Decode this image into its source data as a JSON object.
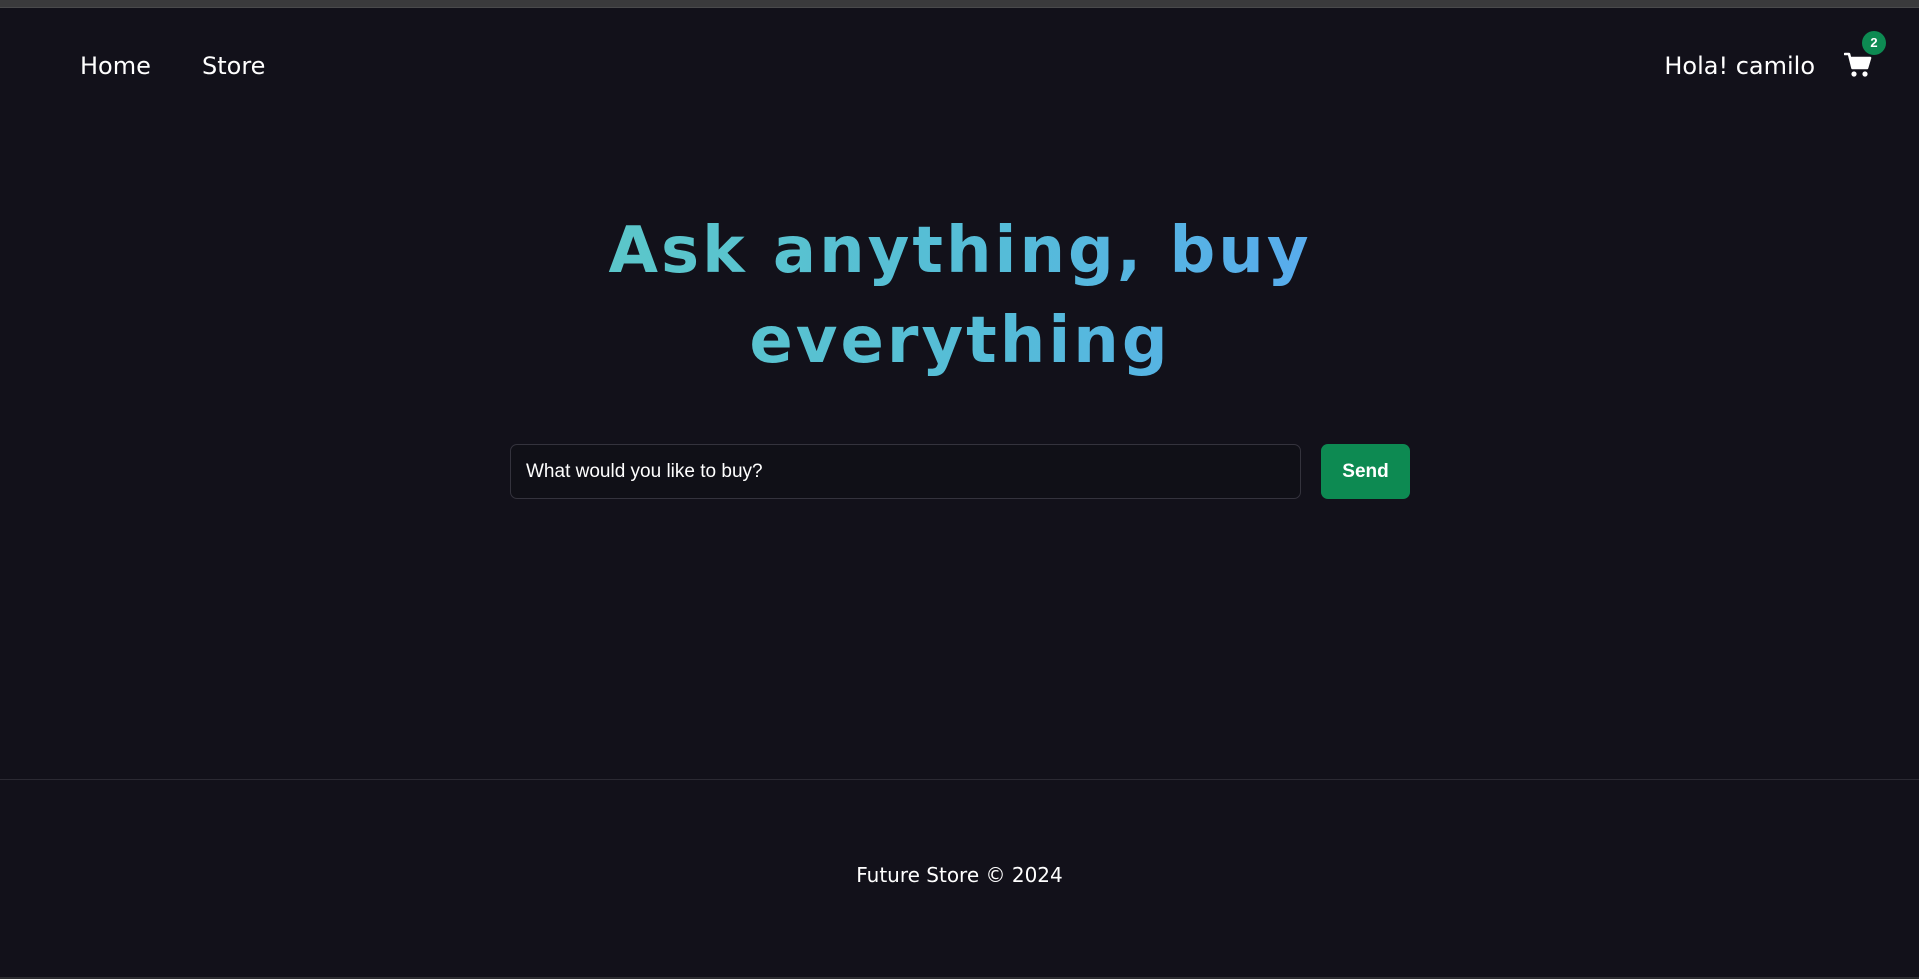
{
  "header": {
    "nav": [
      {
        "label": "Home"
      },
      {
        "label": "Store"
      }
    ],
    "greeting": "Hola! camilo",
    "cart": {
      "icon": "shopping-cart-icon",
      "count": "2"
    }
  },
  "hero": {
    "title": "Ask anything, buy everything",
    "gradient_colors": [
      "#5cc8c8",
      "#58a9f0"
    ]
  },
  "search": {
    "placeholder": "What would you like to buy?",
    "value": "",
    "send_label": "Send"
  },
  "footer": {
    "text": "Future Store © 2024"
  },
  "colors": {
    "background": "#12111a",
    "accent": "#0d8a52"
  }
}
